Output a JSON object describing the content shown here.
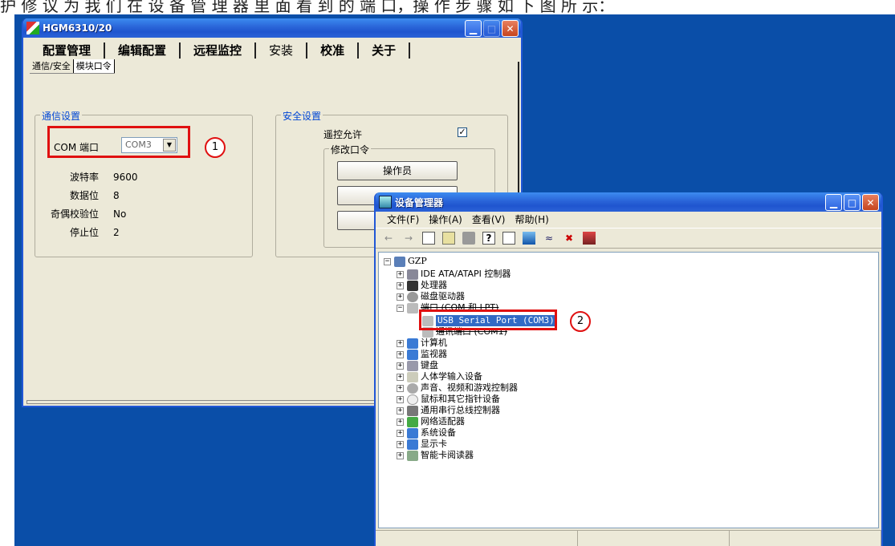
{
  "caption_crop": "护 修 议 为 我 们 在 设 备 管 理 器 里 面 看 到 的 端 口，操 作 步 骤 如 下 图 所 示：",
  "hgm": {
    "title": "HGM6310/20",
    "main_tabs": [
      "配置管理",
      "编辑配置",
      "远程监控",
      "安装",
      "校准",
      "关于"
    ],
    "sub_tabs": [
      "通信/安全",
      "模块口令"
    ],
    "comm": {
      "group_title": "通信设置",
      "com_label": "COM 端口",
      "com_value": "COM3",
      "rows": [
        {
          "k": "波特率",
          "v": "9600"
        },
        {
          "k": "数据位",
          "v": "8"
        },
        {
          "k": "奇偶校验位",
          "v": "No"
        },
        {
          "k": "停止位",
          "v": "2"
        }
      ]
    },
    "security": {
      "group_title": "安全设置",
      "remote_label": "遥控允许",
      "remote_checked": "✓",
      "pwd_group": "修改口令",
      "operator_button": "操作员"
    },
    "marker": "1"
  },
  "devmgr": {
    "title": "设备管理器",
    "menu": [
      "文件(F)",
      "操作(A)",
      "查看(V)",
      "帮助(H)"
    ],
    "root": "GZP",
    "nodes": [
      "IDE ATA/ATAPI 控制器",
      "处理器",
      "磁盘驱动器",
      "端口 (COM 和 LPT)",
      "USB Serial Port (COM3)",
      "通讯端口 (COM1)",
      "计算机",
      "监视器",
      "键盘",
      "人体学输入设备",
      "声音、视频和游戏控制器",
      "鼠标和其它指针设备",
      "通用串行总线控制器",
      "网络适配器",
      "系统设备",
      "显示卡",
      "智能卡阅读器"
    ],
    "marker": "2"
  },
  "colors": {
    "desktop": "#0a4ea8",
    "annotation": "#e01010",
    "selection": "#316ac5"
  }
}
